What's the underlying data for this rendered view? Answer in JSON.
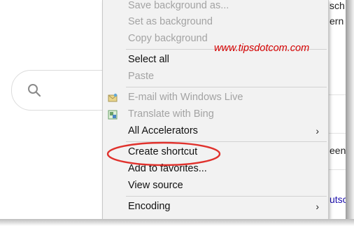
{
  "edge_texts": {
    "top_1": "sch",
    "top_2": "ern",
    "middle": "een",
    "bottom": "utsc"
  },
  "watermark": "www.tipsdotcom.com",
  "menu": {
    "items": [
      {
        "label": "Save background as...",
        "enabled": false
      },
      {
        "label": "Set as background",
        "enabled": false
      },
      {
        "label": "Copy background",
        "enabled": false
      },
      {
        "label": "Select all",
        "enabled": true
      },
      {
        "label": "Paste",
        "enabled": false
      },
      {
        "label": "E-mail with Windows Live",
        "enabled": false,
        "icon": "email-icon"
      },
      {
        "label": "Translate with Bing",
        "enabled": false,
        "icon": "translate-icon"
      },
      {
        "label": "All Accelerators",
        "enabled": true,
        "submenu": true
      },
      {
        "label": "Create shortcut",
        "enabled": true,
        "highlighted": true
      },
      {
        "label": "Add to favorites...",
        "enabled": true
      },
      {
        "label": "View source",
        "enabled": true
      },
      {
        "label": "Encoding",
        "enabled": true,
        "submenu": true
      }
    ],
    "submenu_arrow": "›"
  },
  "colors": {
    "menu_bg": "#f2f2f2",
    "disabled_text": "#a3a3a3",
    "highlight": "#e0312c",
    "watermark": "#d40000"
  }
}
